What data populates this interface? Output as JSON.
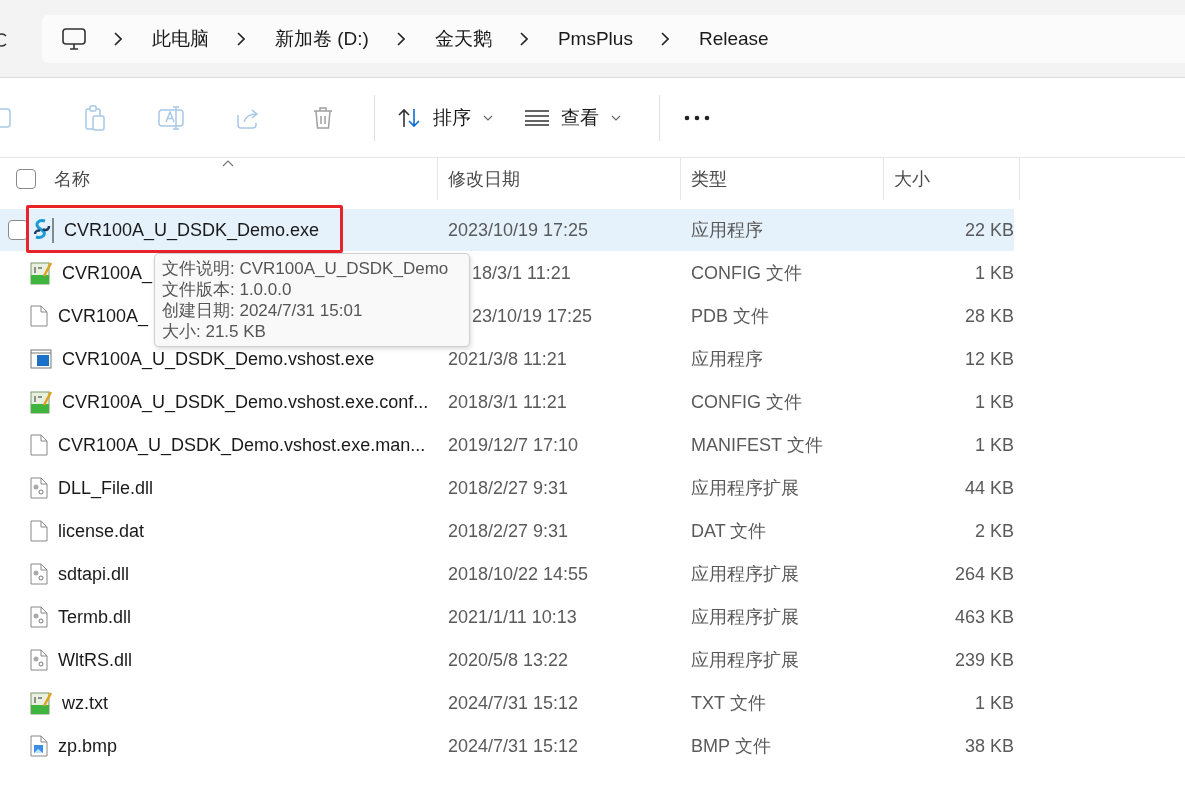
{
  "address_bar": {
    "crumbs": [
      "此电脑",
      "新加卷 (D:)",
      "金天鹅",
      "PmsPlus",
      "Release"
    ]
  },
  "toolbar": {
    "buttons": [
      {
        "kind": "copy",
        "disabled": true
      },
      {
        "kind": "paste",
        "disabled": true
      },
      {
        "kind": "rename",
        "disabled": true
      },
      {
        "kind": "share",
        "disabled": true
      },
      {
        "kind": "delete",
        "disabled": true
      },
      {
        "kind": "sort",
        "label": "排序",
        "disabled": false
      },
      {
        "kind": "view",
        "label": "查看",
        "disabled": false
      },
      {
        "kind": "more",
        "disabled": false
      }
    ]
  },
  "file_list": {
    "select_all": {
      "checked": false
    },
    "columns": [
      "名称",
      "修改日期",
      "类型",
      "大小"
    ],
    "rows": [
      {
        "kind": "app",
        "name": "CVR100A_U_DSDK_Demo.exe",
        "date": "2023/10/19 17:25",
        "type": "应用程序",
        "size": "22 KB",
        "selected": true,
        "highlighted": true,
        "covered": false
      },
      {
        "kind": "config",
        "name": "CVR100A_",
        "date": "18/3/1 11:21",
        "type": "CONFIG 文件",
        "size": "1 KB",
        "selected": false,
        "highlighted": false,
        "covered": true
      },
      {
        "kind": "blank",
        "name": "CVR100A_",
        "date": "23/10/19 17:25",
        "type": "PDB 文件",
        "size": "28 KB",
        "selected": false,
        "highlighted": false,
        "covered": true
      },
      {
        "kind": "window",
        "name": "CVR100A_U_DSDK_Demo.vshost.exe",
        "date": "2021/3/8 11:21",
        "type": "应用程序",
        "size": "12 KB",
        "selected": false,
        "highlighted": false,
        "covered": false
      },
      {
        "kind": "config",
        "name": "CVR100A_U_DSDK_Demo.vshost.exe.conf...",
        "date": "2018/3/1 11:21",
        "type": "CONFIG 文件",
        "size": "1 KB",
        "selected": false,
        "highlighted": false,
        "covered": false
      },
      {
        "kind": "blank",
        "name": "CVR100A_U_DSDK_Demo.vshost.exe.man...",
        "date": "2019/12/7 17:10",
        "type": "MANIFEST 文件",
        "size": "1 KB",
        "selected": false,
        "highlighted": false,
        "covered": false
      },
      {
        "kind": "dll",
        "name": "DLL_File.dll",
        "date": "2018/2/27 9:31",
        "type": "应用程序扩展",
        "size": "44 KB",
        "selected": false,
        "highlighted": false,
        "covered": false
      },
      {
        "kind": "blank",
        "name": "license.dat",
        "date": "2018/2/27 9:31",
        "type": "DAT 文件",
        "size": "2 KB",
        "selected": false,
        "highlighted": false,
        "covered": false
      },
      {
        "kind": "dll",
        "name": "sdtapi.dll",
        "date": "2018/10/22 14:55",
        "type": "应用程序扩展",
        "size": "264 KB",
        "selected": false,
        "highlighted": false,
        "covered": false
      },
      {
        "kind": "dll",
        "name": "Termb.dll",
        "date": "2021/1/11 10:13",
        "type": "应用程序扩展",
        "size": "463 KB",
        "selected": false,
        "highlighted": false,
        "covered": false
      },
      {
        "kind": "dll",
        "name": "WltRS.dll",
        "date": "2020/5/8 13:22",
        "type": "应用程序扩展",
        "size": "239 KB",
        "selected": false,
        "highlighted": false,
        "covered": false
      },
      {
        "kind": "config",
        "name": "wz.txt",
        "date": "2024/7/31 15:12",
        "type": "TXT 文件",
        "size": "1 KB",
        "selected": false,
        "highlighted": false,
        "covered": false
      },
      {
        "kind": "image",
        "name": "zp.bmp",
        "date": "2024/7/31 15:12",
        "type": "BMP 文件",
        "size": "38 KB",
        "selected": false,
        "highlighted": false,
        "covered": false
      }
    ]
  },
  "tooltip": {
    "lines": [
      "文件说明: CVR100A_U_DSDK_Demo",
      "文件版本: 1.0.0.0",
      "创建日期: 2024/7/31 15:01",
      "大小: 21.5 KB"
    ]
  }
}
